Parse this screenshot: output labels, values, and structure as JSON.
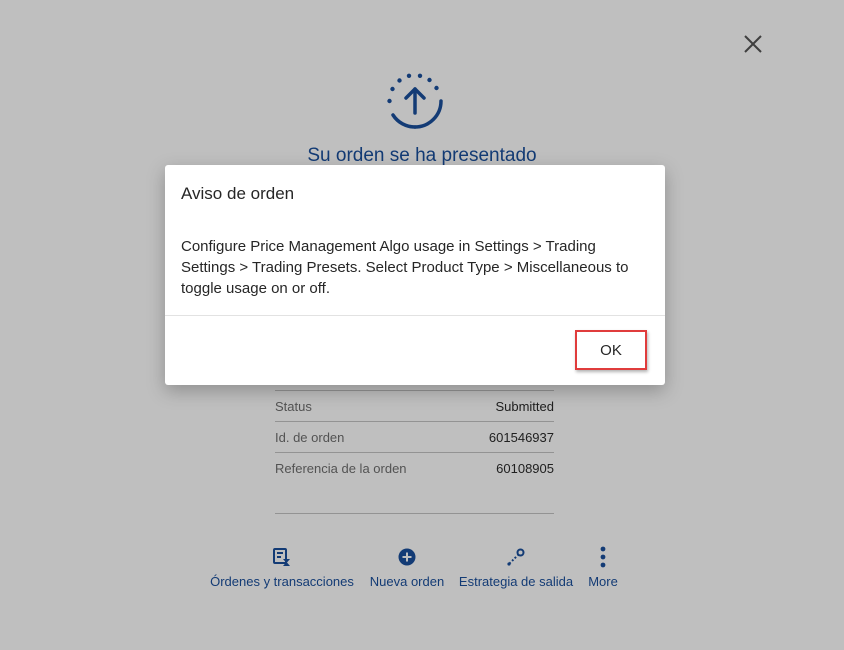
{
  "background": {
    "close_icon": "close-icon",
    "status_icon": "upload-arrow-icon",
    "confirmation_title": "Su orden se ha presentado",
    "details": [
      {
        "label": "Status",
        "value": "Submitted"
      },
      {
        "label": "Id. de orden",
        "value": "601546937"
      },
      {
        "label": "Referencia de la orden",
        "value": "60108905"
      }
    ],
    "actions": [
      {
        "label": "Órdenes y transacciones",
        "icon": "orders-transactions-icon"
      },
      {
        "label": "Nueva orden",
        "icon": "plus-circle-icon"
      },
      {
        "label": "Estrategia de salida",
        "icon": "exit-strategy-icon"
      },
      {
        "label": "More",
        "icon": "more-vertical-icon"
      }
    ]
  },
  "dialog": {
    "title": "Aviso de orden",
    "message": "Configure Price Management Algo usage in Settings > Trading Settings > Trading Presets. Select Product Type > Miscellaneous to toggle usage on or off.",
    "ok_label": "OK"
  },
  "colors": {
    "accent": "#1a4f9c",
    "highlight_border": "#e03c3c",
    "overlay": "rgba(0,0,0,0.25)"
  }
}
